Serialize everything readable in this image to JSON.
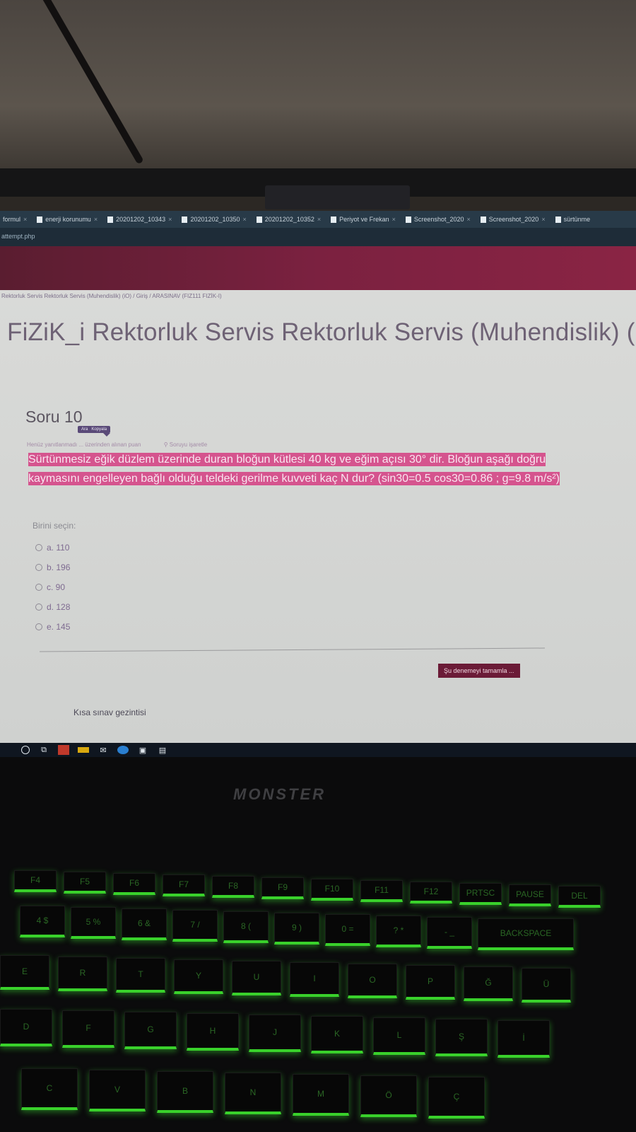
{
  "browser": {
    "tabs": [
      {
        "label": "formul",
        "icon": "tab-icon"
      },
      {
        "label": "enerji korunumu",
        "icon": "globe-icon"
      },
      {
        "label": "20201202_10343",
        "icon": "file-icon"
      },
      {
        "label": "20201202_10350",
        "icon": "file-icon"
      },
      {
        "label": "20201202_10352",
        "icon": "file-icon"
      },
      {
        "label": "Periyot ve Frekan",
        "icon": "file-icon"
      },
      {
        "label": "Screenshot_2020",
        "icon": "file-icon"
      },
      {
        "label": "Screenshot_2020",
        "icon": "file-icon"
      },
      {
        "label": "sürtünme",
        "icon": "file-icon"
      }
    ],
    "tab_close": "×",
    "url": "attempt.php"
  },
  "page": {
    "breadcrumb": "Rektorluk Servis Rektorluk Servis (Muhendislik) (iO) / Giriş / ARASINAV (FIZ111 FIZİK-I)",
    "course_title": "FiZiK_i Rektorluk Servis Rektorluk Servis (Muhendislik) (iO)",
    "question_heading": "Soru 10",
    "tooltip": {
      "search": "Ara",
      "copy": "Kopyala"
    },
    "question_meta": "Henüz yanıtlanmadı ... üzerinden alınan puan",
    "flag_label": "Soruyu işaretle",
    "question_text": "Sürtünmesiz eğik düzlem üzerinde duran bloğun kütlesi 40 kg ve eğim açısı 30° dir. Bloğun aşağı doğru kaymasını engelleyen bağlı olduğu teldeki gerilme kuvveti kaç N dur? (sin30=0.5 cos30=0.86 ; g=9.8 m/s²)",
    "choose_label": "Birini seçin:",
    "answers": [
      {
        "label": "a. 110"
      },
      {
        "label": "b. 196"
      },
      {
        "label": "c. 90"
      },
      {
        "label": "d. 128"
      },
      {
        "label": "e. 145"
      }
    ],
    "finish_button": "Şu denemeyi tamamla ...",
    "quiz_navigation": "Kısa sınav gezintisi"
  },
  "taskbar": {
    "icons": [
      "start-icon",
      "search-icon",
      "task-view-icon",
      "opera-icon",
      "file-explorer-icon",
      "mail-icon",
      "edge-icon",
      "store-icon",
      "word-icon"
    ]
  },
  "laptop": {
    "brand": "MONSTER"
  },
  "keyboard": {
    "rows": [
      [
        "F4",
        "F5",
        "F6",
        "F7",
        "F8",
        "F9",
        "F10",
        "F11",
        "F12",
        "PRTSC",
        "PAUSE",
        "DEL"
      ],
      [
        "4 $",
        "5 %",
        "6 &",
        "7 /",
        "8 (",
        "9 )",
        "0 =",
        "? *",
        "- _",
        "BACKSPACE"
      ],
      [
        "E",
        "R",
        "T",
        "Y",
        "U",
        "I",
        "O",
        "P",
        "Ğ",
        "Ü"
      ],
      [
        "D",
        "F",
        "G",
        "H",
        "J",
        "K",
        "L",
        "Ş",
        "İ"
      ],
      [
        "C",
        "V",
        "B",
        "N",
        "M",
        "Ö",
        "Ç"
      ]
    ]
  },
  "colors": {
    "highlight": "#d5548e",
    "header_bar": "#7b2140",
    "key_glow": "#39d12b"
  }
}
